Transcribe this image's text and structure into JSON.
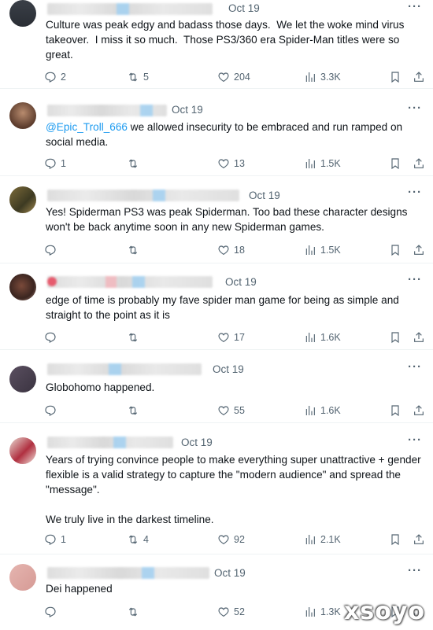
{
  "tweets": [
    {
      "date": "Oct 19",
      "text": "Culture was peak edgy and badass those days.  We let the woke mind virus takeover.  I miss it so much.  Those PS3/360 era Spider-Man titles were so great.",
      "replies": "2",
      "retweets": "5",
      "likes": "204",
      "views": "3.3K"
    },
    {
      "date": "Oct 19",
      "mention": "@Epic_Troll_666",
      "text": " we allowed insecurity to be embraced and run ramped on social media.",
      "replies": "1",
      "retweets": "",
      "likes": "13",
      "views": "1.5K"
    },
    {
      "date": "Oct 19",
      "text": "Yes! Spiderman PS3 was peak Spiderman. Too bad these character designs won't be back anytime soon in any new Spiderman games.",
      "replies": "",
      "retweets": "",
      "likes": "18",
      "views": "1.5K"
    },
    {
      "date": "Oct 19",
      "text": "edge of time is probably my fave spider man game for being as simple and straight to the point as it is",
      "replies": "",
      "retweets": "",
      "likes": "17",
      "views": "1.6K"
    },
    {
      "date": "Oct 19",
      "text": "Globohomo happened.",
      "replies": "",
      "retweets": "",
      "likes": "55",
      "views": "1.6K"
    },
    {
      "date": "Oct 19",
      "text": "Years of trying convince people to make everything super unattractive + gender flexible is a valid strategy to capture the \"modern audience\" and spread the \"message\".\n\nWe truly live in the darkest timeline.",
      "replies": "1",
      "retweets": "4",
      "likes": "92",
      "views": "2.1K"
    },
    {
      "date": "Oct 19",
      "text": "Dei happened",
      "replies": "",
      "retweets": "",
      "likes": "52",
      "views": "1.3K"
    }
  ],
  "more_label": "···",
  "watermark": "xsoyo",
  "icons": [
    "reply-icon",
    "retweet-icon",
    "like-icon",
    "views-icon",
    "bookmark-icon",
    "share-icon"
  ]
}
